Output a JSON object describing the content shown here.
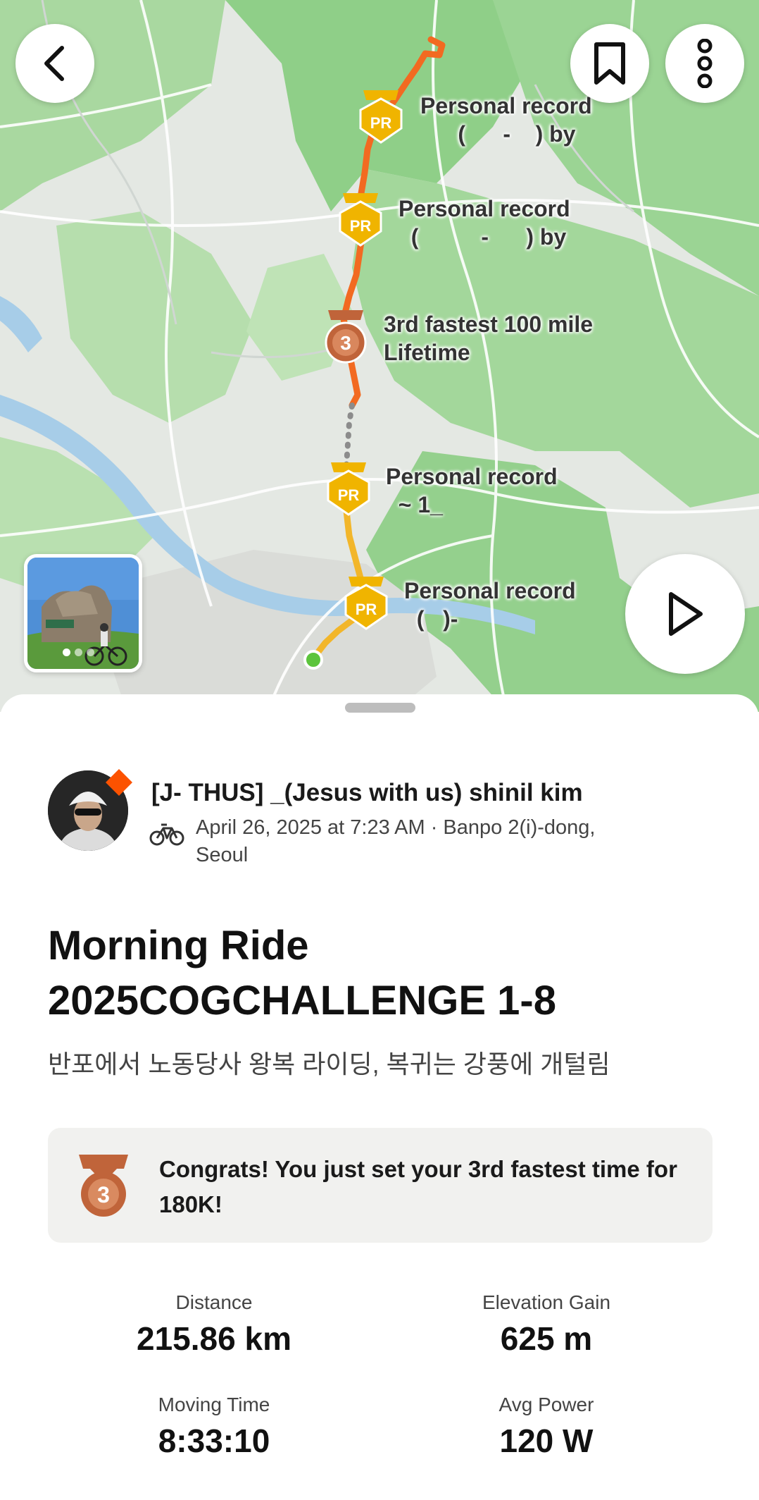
{
  "icons": {
    "back": "chevron-left-icon",
    "bookmark": "bookmark-icon",
    "more": "more-vertical-icon",
    "play": "play-icon",
    "sport": "bicycle-icon",
    "medal": "bronze-medal-icon",
    "pr_badge": "pr-medal-icon"
  },
  "map": {
    "markers": [
      {
        "type": "PR",
        "badge_text": "PR",
        "label": "Personal record\n      (      -    ) by"
      },
      {
        "type": "PR",
        "badge_text": "PR",
        "label": "Personal record\n  (          -      ) by"
      },
      {
        "type": "rank",
        "badge_text": "3",
        "label": "3rd fastest 100 mile\nLifetime"
      },
      {
        "type": "PR",
        "badge_text": "PR",
        "label": "Personal record\n  ~ 1_"
      },
      {
        "type": "PR",
        "badge_text": "PR",
        "label": "Personal record\n  (   )-"
      }
    ],
    "photo_count": 3
  },
  "athlete": {
    "name": "[J- THUS] _(Jesus with us) shinil kim",
    "meta": "April 26, 2025 at 7:23 AM · Banpo 2(i)-dong, Seoul"
  },
  "activity": {
    "title": "Morning Ride 2025COGCHALLENGE 1-8",
    "description": "반포에서 노동당사 왕복 라이딩, 복귀는 강풍에 개털림"
  },
  "achievement": {
    "rank": "3",
    "text": "Congrats! You just set your 3rd fastest time for 180K!"
  },
  "stats": {
    "distance": {
      "label": "Distance",
      "value": "215.86 km"
    },
    "elevation": {
      "label": "Elevation Gain",
      "value": "625 m"
    },
    "moving_time": {
      "label": "Moving Time",
      "value": "8:33:10"
    },
    "avg_power": {
      "label": "Avg Power",
      "value": "120 W"
    }
  },
  "colors": {
    "strava_orange": "#fc5200",
    "pr_gold": "#f0b400",
    "bronze": "#c0643a",
    "route_orange": "#f26a21",
    "route_yellow": "#f2b62a",
    "start_green": "#5cc43c",
    "map_green": "#9fd39a"
  }
}
